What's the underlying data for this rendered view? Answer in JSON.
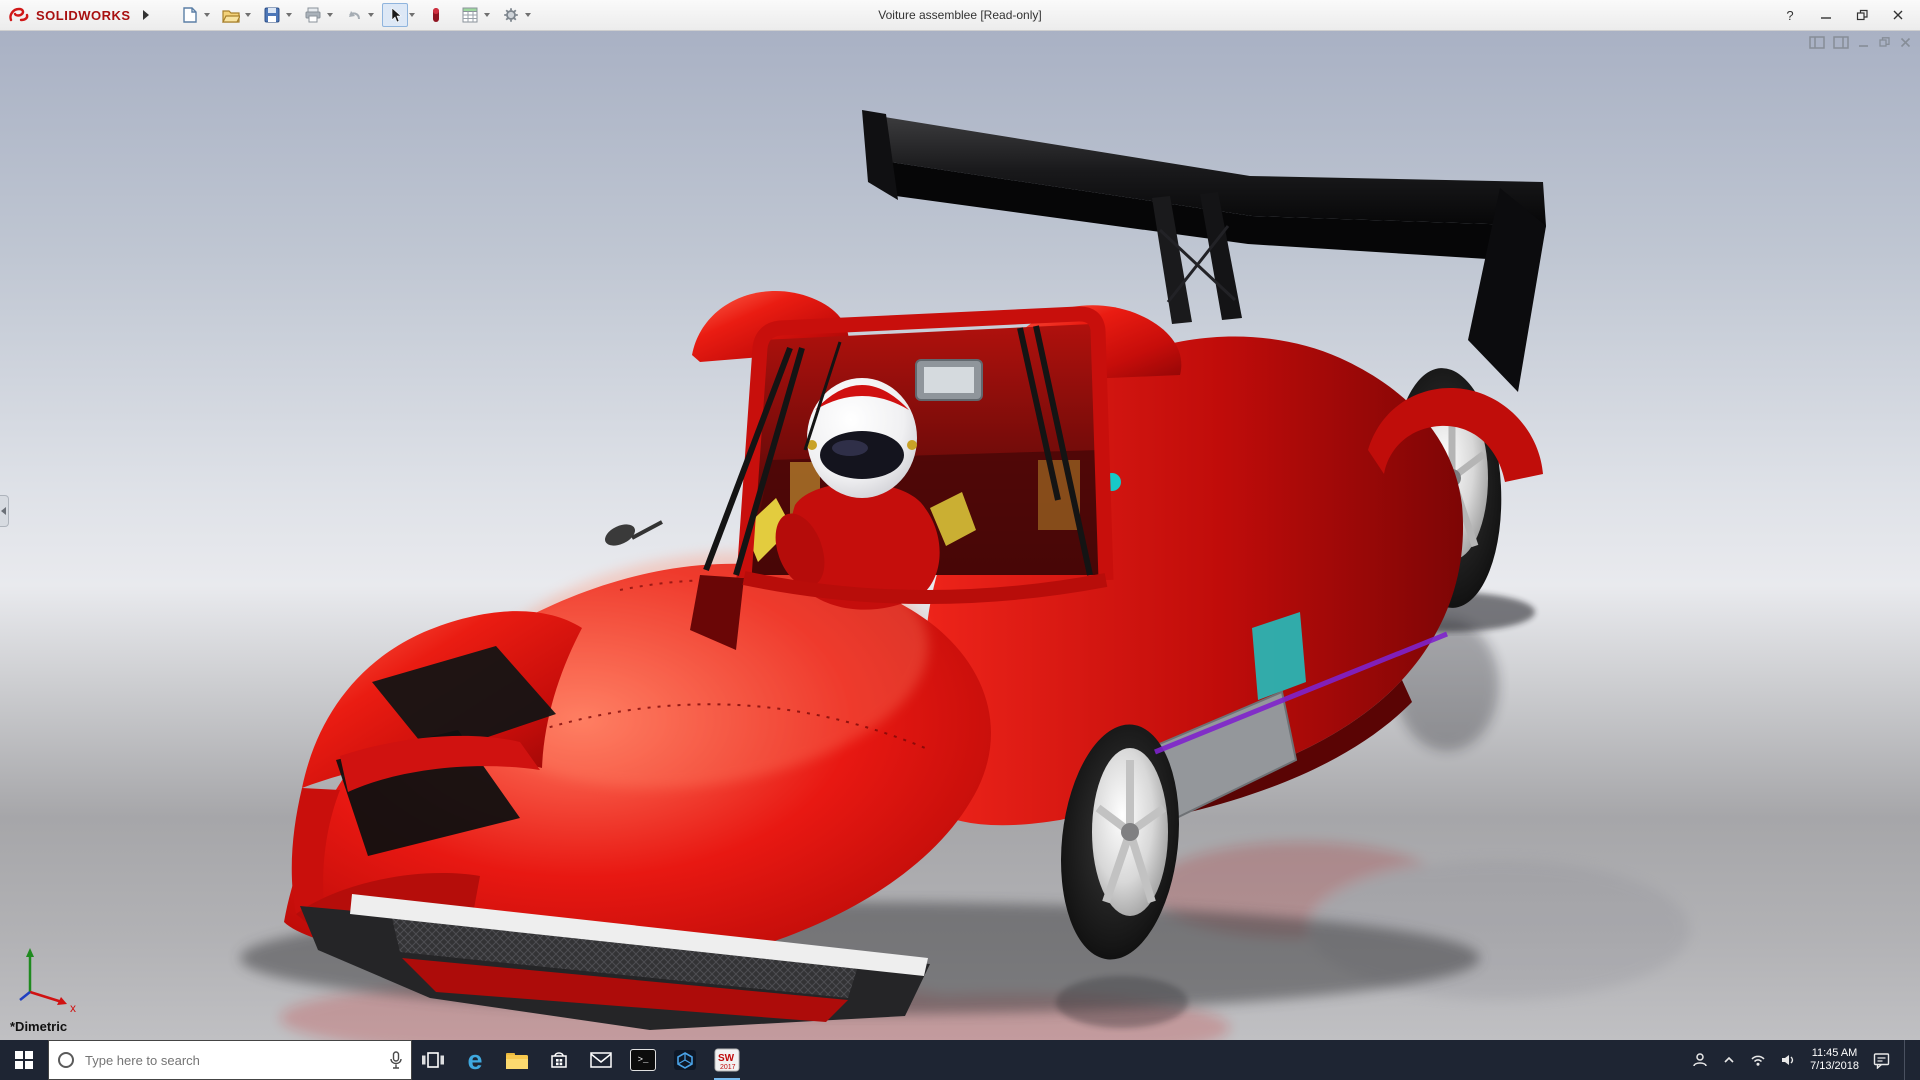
{
  "titlebar": {
    "brand": "SOLIDWORKS",
    "title": "Voiture assemblee [Read-only]",
    "help_label": "?",
    "toolbar_icons": [
      "new-document",
      "open",
      "save",
      "print",
      "undo",
      "select-tool",
      "appearance",
      "design-table",
      "options"
    ],
    "window_icons": [
      "minimize",
      "restore",
      "close"
    ]
  },
  "viewport": {
    "view_label": "*Dimetric",
    "triad_x_label": "x",
    "pane_icons": [
      "split-pane-left",
      "split-pane-right",
      "minimize-view",
      "restore-view",
      "close-view"
    ]
  },
  "car": {
    "colors": {
      "body_red": "#e01511",
      "wing_black": "#121214",
      "trim_purple": "#7e22cc",
      "accent_teal": "#23bdbd",
      "accent_yellow": "#e3cc3e",
      "rim_silver": "#d8d8d8"
    }
  },
  "taskbar": {
    "search_placeholder": "Type here to search",
    "clock": {
      "time": "11:45 AM",
      "date": "7/13/2018"
    },
    "edge_glyph": "e",
    "cmd_glyph": ">_",
    "sw_glyph": "SW",
    "sw_year": "2017",
    "icons": [
      "start",
      "search",
      "microphone",
      "task-view",
      "edge",
      "file-explorer",
      "store",
      "mail",
      "command-prompt",
      "edrawings",
      "solidworks-2017",
      "people",
      "hidden-icons",
      "network",
      "volume",
      "clock",
      "action-center"
    ]
  }
}
